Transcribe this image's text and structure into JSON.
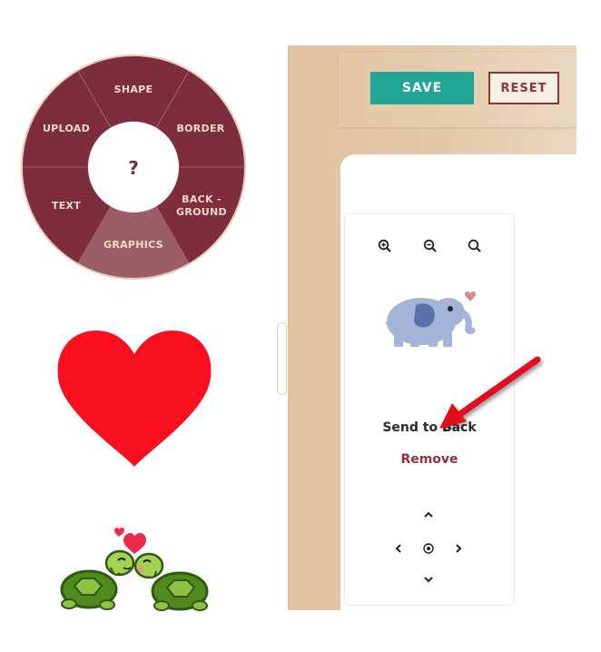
{
  "radial_menu": {
    "segments": {
      "shape": "SHAPE",
      "border": "BORDER",
      "background_line1": "BACK -",
      "background_line2": "GROUND",
      "graphics": "GRAPHICS",
      "text": "TEXT",
      "upload": "UPLOAD"
    },
    "center_label": "?",
    "active_segment": "graphics",
    "colors": {
      "menu": "#7d2d3d",
      "active": "#9c5e66",
      "label": "#f4dcc6"
    }
  },
  "library": {
    "items": [
      {
        "icon": "heart-icon",
        "color": "#fb0f1f"
      },
      {
        "icon": "turtles-in-love-icon"
      }
    ]
  },
  "toolbar": {
    "save_label": "SAVE",
    "reset_label": "RESET"
  },
  "graphic_options": {
    "zoom_icons": [
      "zoom-in-icon",
      "zoom-out-icon",
      "zoom-reset-icon"
    ],
    "selected_graphic": "elephant-icon",
    "send_to_back_label": "Send to Back",
    "remove_label": "Remove",
    "nav_icons": [
      "chevron-up-icon",
      "chevron-left-icon",
      "center-icon",
      "chevron-right-icon",
      "chevron-down-icon"
    ]
  },
  "annotation": {
    "icon": "red-arrow-icon",
    "color": "#e30f1c"
  },
  "colors": {
    "save_button": "#22a596",
    "reset_border": "#8c3340",
    "panel_background": "#e2c7a6"
  }
}
